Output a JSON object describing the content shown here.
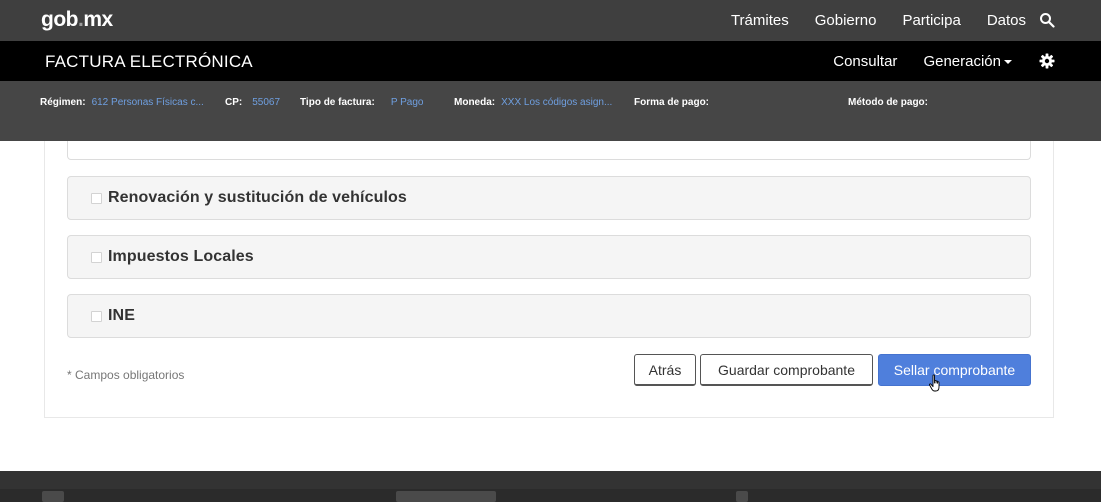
{
  "brand": {
    "logo_main": "gob",
    "logo_dot": ".",
    "logo_end": "mx"
  },
  "top_nav": [
    "Trámites",
    "Gobierno",
    "Participa",
    "Datos"
  ],
  "app": {
    "title": "FACTURA ELECTRÓNICA",
    "nav_consultar": "Consultar",
    "nav_generacion": "Generación"
  },
  "info": {
    "regimen_label": "Régimen:",
    "regimen_value": "612 Personas Físicas c...",
    "cp_label": "CP:",
    "cp_value": "55067",
    "tipo_label": "Tipo de factura:",
    "tipo_value": "P Pago",
    "moneda_label": "Moneda:",
    "moneda_value": "XXX Los códigos asign...",
    "forma_label": "Forma de pago:",
    "metodo_label": "Método de pago:"
  },
  "sections": [
    {
      "label": "Renovación y sustitución de vehículos"
    },
    {
      "label": "Impuestos Locales"
    },
    {
      "label": "INE"
    }
  ],
  "form": {
    "required_note": "* Campos obligatorios",
    "back_label": "Atrás",
    "save_label": "Guardar comprobante",
    "seal_label": "Sellar comprobante"
  },
  "colors": {
    "accent": "#4f7fdc",
    "link": "#6f9fe0",
    "topbar": "#3f3f3f",
    "appbar": "#000000"
  },
  "icons": {
    "search": "search-icon",
    "settings": "gear-icon",
    "pointer": "hand-cursor-icon"
  }
}
